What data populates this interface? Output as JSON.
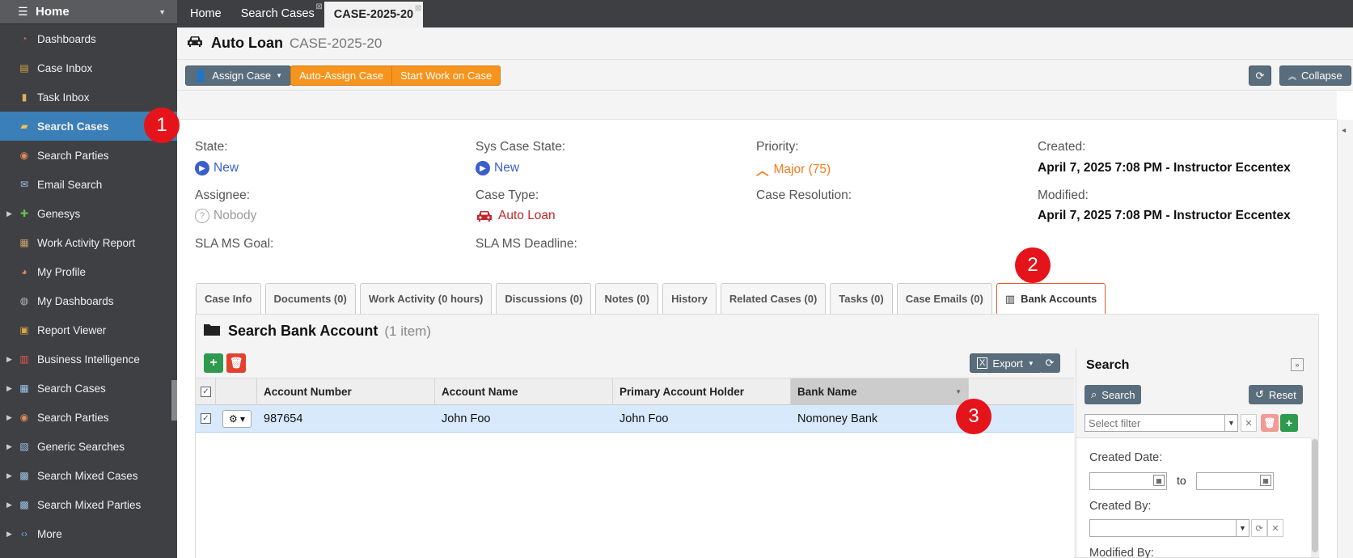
{
  "sidebar": {
    "home_label": "Home",
    "items": [
      {
        "label": "Dashboards",
        "icon": "pie-chart-icon",
        "expandable": false,
        "active": false
      },
      {
        "label": "Case Inbox",
        "icon": "inbox-icon",
        "expandable": false,
        "active": false
      },
      {
        "label": "Task Inbox",
        "icon": "clipboard-icon",
        "expandable": false,
        "active": false
      },
      {
        "label": "Search Cases",
        "icon": "folder-search-icon",
        "expandable": false,
        "active": true
      },
      {
        "label": "Search Parties",
        "icon": "people-search-icon",
        "expandable": false,
        "active": false
      },
      {
        "label": "Email Search",
        "icon": "envelope-icon",
        "expandable": false,
        "active": false
      },
      {
        "label": "Genesys",
        "icon": "puzzle-icon",
        "expandable": true,
        "active": false
      },
      {
        "label": "Work Activity Report",
        "icon": "report-icon",
        "expandable": false,
        "active": false
      },
      {
        "label": "My Profile",
        "icon": "user-icon",
        "expandable": false,
        "active": false
      },
      {
        "label": "My Dashboards",
        "icon": "dashboard-icon",
        "expandable": false,
        "active": false
      },
      {
        "label": "Report Viewer",
        "icon": "report-viewer-icon",
        "expandable": false,
        "active": false
      },
      {
        "label": "Business Intelligence",
        "icon": "bar-chart-icon",
        "expandable": true,
        "active": false
      },
      {
        "label": "Search Cases",
        "icon": "table-icon",
        "expandable": true,
        "active": false
      },
      {
        "label": "Search Parties",
        "icon": "people-icon",
        "expandable": true,
        "active": false
      },
      {
        "label": "Generic Searches",
        "icon": "search-doc-icon",
        "expandable": true,
        "active": false
      },
      {
        "label": "Search Mixed Cases",
        "icon": "mixed-icon",
        "expandable": true,
        "active": false
      },
      {
        "label": "Search Mixed Parties",
        "icon": "mixed-icon",
        "expandable": true,
        "active": false
      },
      {
        "label": "More",
        "icon": "code-icon",
        "expandable": true,
        "active": false
      }
    ]
  },
  "top_tabs": [
    {
      "label": "Home",
      "closable": false,
      "active": false
    },
    {
      "label": "Search Cases",
      "closable": true,
      "active": false
    },
    {
      "label": "CASE-2025-20",
      "closable": true,
      "active": true
    }
  ],
  "case": {
    "type_name": "Auto Loan",
    "case_id": "CASE-2025-20"
  },
  "actions": {
    "assign": "Assign Case",
    "auto_assign": "Auto-Assign Case",
    "start_work": "Start Work on Case",
    "collapse": "Collapse"
  },
  "fields": {
    "state_label": "State:",
    "state_value": "New",
    "sys_state_label": "Sys Case State:",
    "sys_state_value": "New",
    "priority_label": "Priority:",
    "priority_value": "Major (75)",
    "created_label": "Created:",
    "created_value": "April 7, 2025 7:08 PM - Instructor Eccentex",
    "assignee_label": "Assignee:",
    "assignee_value": "Nobody",
    "case_type_label": "Case Type:",
    "case_type_value": "Auto Loan",
    "resolution_label": "Case Resolution:",
    "modified_label": "Modified:",
    "modified_value": "April 7, 2025 7:08 PM - Instructor Eccentex",
    "sla_goal_label": "SLA MS Goal:",
    "sla_deadline_label": "SLA MS Deadline:"
  },
  "case_tabs": [
    "Case Info",
    "Documents (0)",
    "Work Activity (0 hours)",
    "Discussions (0)",
    "Notes (0)",
    "History",
    "Related Cases (0)",
    "Tasks (0)",
    "Case Emails (0)",
    "Bank Accounts"
  ],
  "bank_panel": {
    "title": "Search Bank Account",
    "count": "(1 item)",
    "export": "Export",
    "columns": [
      "Account Number",
      "Account Name",
      "Primary Account Holder",
      "Bank Name"
    ],
    "rows": [
      {
        "account_number": "987654",
        "account_name": "John Foo",
        "primary_holder": "John Foo",
        "bank_name": "Nomoney Bank"
      }
    ]
  },
  "search_pane": {
    "title": "Search",
    "search_button": "Search",
    "reset_button": "Reset",
    "filter_placeholder": "Select filter",
    "created_date_label": "Created Date:",
    "to_label": "to",
    "created_by_label": "Created By:",
    "modified_by_label": "Modified By:"
  },
  "markers": [
    "1",
    "2",
    "3"
  ],
  "colors": {
    "sidebar_bg": "#3f4044",
    "active_blue": "#3a7fb7",
    "orange": "#f7941d",
    "marker_red": "#e5141b",
    "row_selected": "#d7e9fb"
  }
}
